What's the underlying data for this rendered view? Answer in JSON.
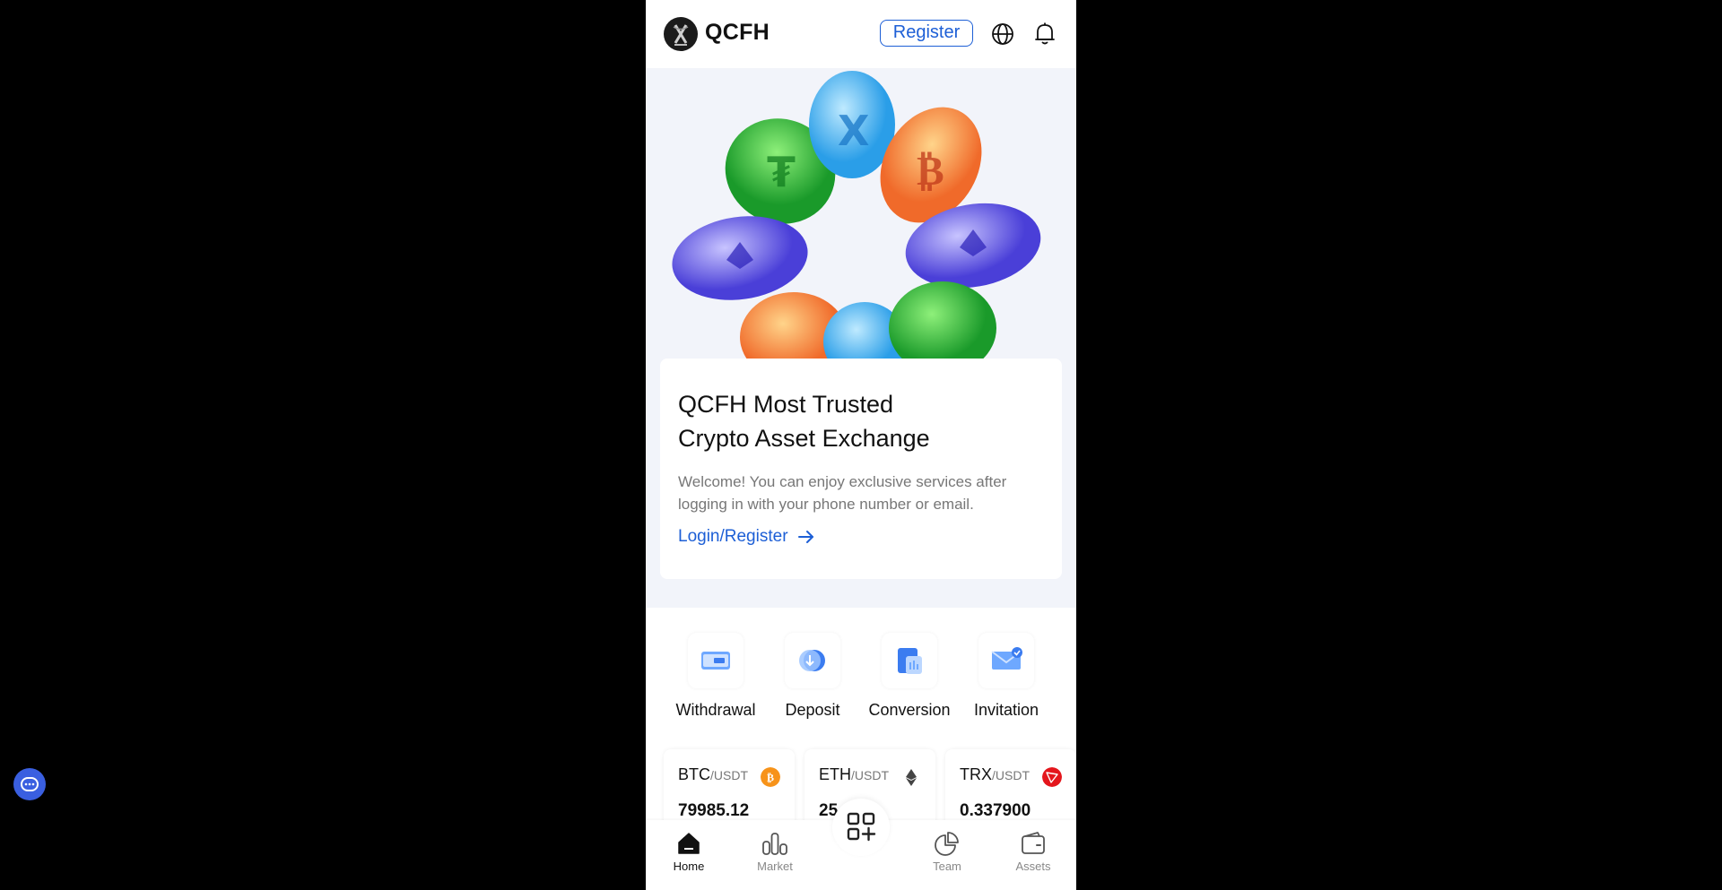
{
  "header": {
    "brand": "QCFH",
    "register_label": "Register"
  },
  "hero": {
    "title_line1": "QCFH Most Trusted",
    "title_line2": "Crypto Asset Exchange",
    "description": "Welcome! You can enjoy exclusive services after logging in with your phone number or email.",
    "link_label": "Login/Register"
  },
  "actions": [
    {
      "label": "Withdrawal",
      "icon": "withdrawal-icon"
    },
    {
      "label": "Deposit",
      "icon": "deposit-icon"
    },
    {
      "label": "Conversion",
      "icon": "conversion-icon"
    },
    {
      "label": "Invitation",
      "icon": "invitation-icon"
    }
  ],
  "tickers": [
    {
      "base": "BTC",
      "quote": "/USDT",
      "price": "79985.12",
      "color": "#f7931a",
      "icon": "btc-icon"
    },
    {
      "base": "ETH",
      "quote": "/USDT",
      "price": "25",
      "color": "#444444",
      "icon": "eth-icon"
    },
    {
      "base": "TRX",
      "quote": "/USDT",
      "price": "0.337900",
      "color": "#e4161c",
      "icon": "trx-icon"
    }
  ],
  "nav": [
    {
      "label": "Home",
      "icon": "home-icon",
      "active": true
    },
    {
      "label": "Market",
      "icon": "market-icon"
    },
    {
      "label": "Team",
      "icon": "team-icon"
    },
    {
      "label": "Assets",
      "icon": "wallet-icon"
    }
  ],
  "colors": {
    "accent": "#1d5fd6",
    "hero_bg": "#f2f4fa",
    "chat_button": "#3a5fe0"
  }
}
